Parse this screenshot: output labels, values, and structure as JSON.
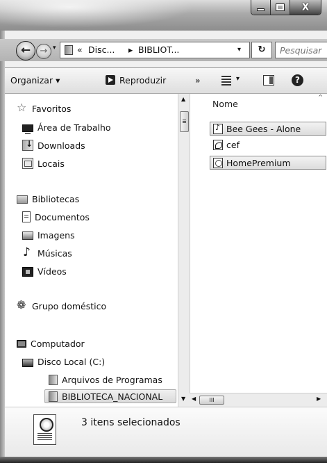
{
  "window": {
    "minimize_glyph": "_",
    "maximize_glyph": "□",
    "close_glyph": "X"
  },
  "address": {
    "back_icon": "back-arrow-icon",
    "forward_icon": "forward-arrow-icon",
    "chevrons": "«",
    "crumb_1": "Disc...",
    "separator": "▸",
    "crumb_2": "BIBLIOT...",
    "dropdown": "▾",
    "refresh_glyph": "⁴⁄",
    "search_placeholder": "Pesquisar"
  },
  "toolbar": {
    "organize_label": "Organizar ▾",
    "play_label": "Reproduzir",
    "overflow_label": "»",
    "views_dropdown": "▾",
    "help_glyph": "?"
  },
  "nav": {
    "favorites": "Favoritos",
    "desktop": "Área de Trabalho",
    "downloads": "Downloads",
    "places": "Locais",
    "libraries": "Bibliotecas",
    "documents": "Documentos",
    "images": "Imagens",
    "music": "Músicas",
    "videos": "Vídeos",
    "homegroup": "Grupo doméstico",
    "computer": "Computador",
    "local_disk": "Disco Local (C:)",
    "program_files": "Arquivos de Programas",
    "biblioteca": "BIBLIOTECA_NACIONAL"
  },
  "content": {
    "column_name": "Nome",
    "files": [
      {
        "name": "Bee Gees - Alone",
        "icon": "music-file-icon"
      },
      {
        "name": "cef",
        "icon": "pdf-file-icon"
      },
      {
        "name": "HomePremium",
        "icon": "html-file-icon"
      }
    ]
  },
  "details": {
    "status": "3 itens selecionados"
  },
  "scroll": {
    "up": "▲",
    "down": "▼",
    "left": "◀",
    "right": "▶",
    "grip": "III"
  }
}
